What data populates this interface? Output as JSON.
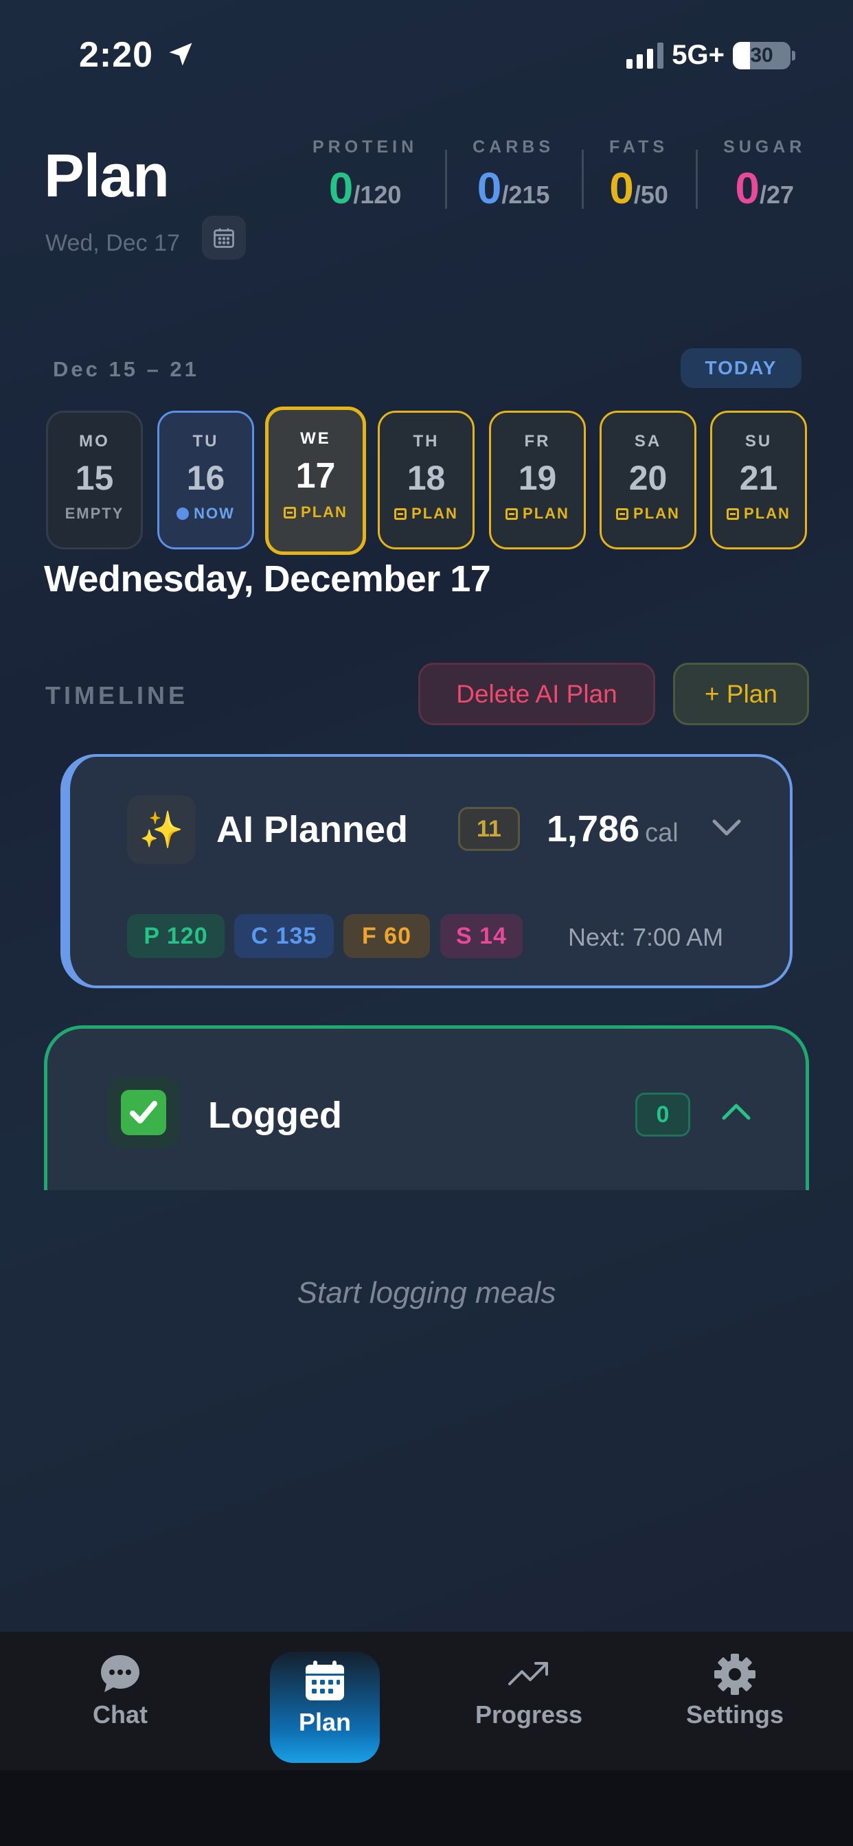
{
  "status_bar": {
    "time": "2:20",
    "network": "5G+",
    "battery": "30"
  },
  "header": {
    "title": "Plan",
    "date": "Wed, Dec 17",
    "macros": [
      {
        "label": "PROTEIN",
        "value": "0",
        "goal": "/120",
        "color": "#27c287"
      },
      {
        "label": "CARBS",
        "value": "0",
        "goal": "/215",
        "color": "#5a98ef"
      },
      {
        "label": "FATS",
        "value": "0",
        "goal": "/50",
        "color": "#e4b419"
      },
      {
        "label": "SUGAR",
        "value": "0",
        "goal": "/27",
        "color": "#e8499b"
      }
    ]
  },
  "week": {
    "range": "Dec 15 – 21",
    "today_label": "TODAY",
    "days": [
      {
        "name": "MO",
        "date": "15",
        "status": "EMPTY"
      },
      {
        "name": "TU",
        "date": "16",
        "status": "NOW"
      },
      {
        "name": "WE",
        "date": "17",
        "status": "PLAN"
      },
      {
        "name": "TH",
        "date": "18",
        "status": "PLAN"
      },
      {
        "name": "FR",
        "date": "19",
        "status": "PLAN"
      },
      {
        "name": "SA",
        "date": "20",
        "status": "PLAN"
      },
      {
        "name": "SU",
        "date": "21",
        "status": "PLAN"
      }
    ]
  },
  "selected_date": "Wednesday, December 17",
  "timeline": {
    "label": "TIMELINE",
    "delete_label": "Delete AI Plan",
    "add_label": "+ Plan"
  },
  "ai_card": {
    "icon": "✨",
    "title": "AI Planned",
    "count": "11",
    "calories": "1,786",
    "cal_unit": "cal",
    "pills": {
      "protein": "P 120",
      "carbs": "C 135",
      "fats": "F 60",
      "sugar": "S 14"
    },
    "next": "Next: 7:00 AM"
  },
  "logged_card": {
    "title": "Logged",
    "count": "0"
  },
  "empty_message": "Start logging meals",
  "tabbar": {
    "chat": "Chat",
    "plan": "Plan",
    "progress": "Progress",
    "settings": "Settings"
  },
  "colors": {
    "accent_blue": "#5c8fe6",
    "accent_yellow": "#e4b419",
    "accent_green": "#1fa970",
    "delete_red": "#ef4a6e"
  }
}
